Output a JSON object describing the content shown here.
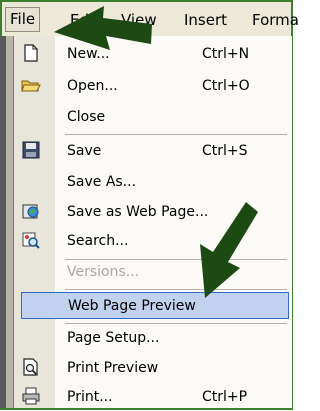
{
  "menubar": {
    "items": [
      {
        "label": "File"
      },
      {
        "label": "Edit"
      },
      {
        "label": "View"
      },
      {
        "label": "Insert"
      },
      {
        "label": "Forma"
      }
    ]
  },
  "menu": {
    "new": {
      "label": "New...",
      "shortcut": "Ctrl+N"
    },
    "open": {
      "label": "Open...",
      "shortcut": "Ctrl+O"
    },
    "close": {
      "label": "Close"
    },
    "save": {
      "label": "Save",
      "shortcut": "Ctrl+S"
    },
    "save_as": {
      "label": "Save As..."
    },
    "save_web": {
      "label": "Save as Web Page..."
    },
    "search": {
      "label": "Search..."
    },
    "versions": {
      "label": "Versions..."
    },
    "web_preview": {
      "label": "Web Page Preview"
    },
    "page_setup": {
      "label": "Page Setup..."
    },
    "print_preview": {
      "label": "Print Preview"
    },
    "print": {
      "label": "Print...",
      "shortcut": "Ctrl+P"
    }
  },
  "colors": {
    "highlight": "#c1d2ee",
    "arrow": "#1c4a12",
    "frame": "#3f7e2e"
  }
}
